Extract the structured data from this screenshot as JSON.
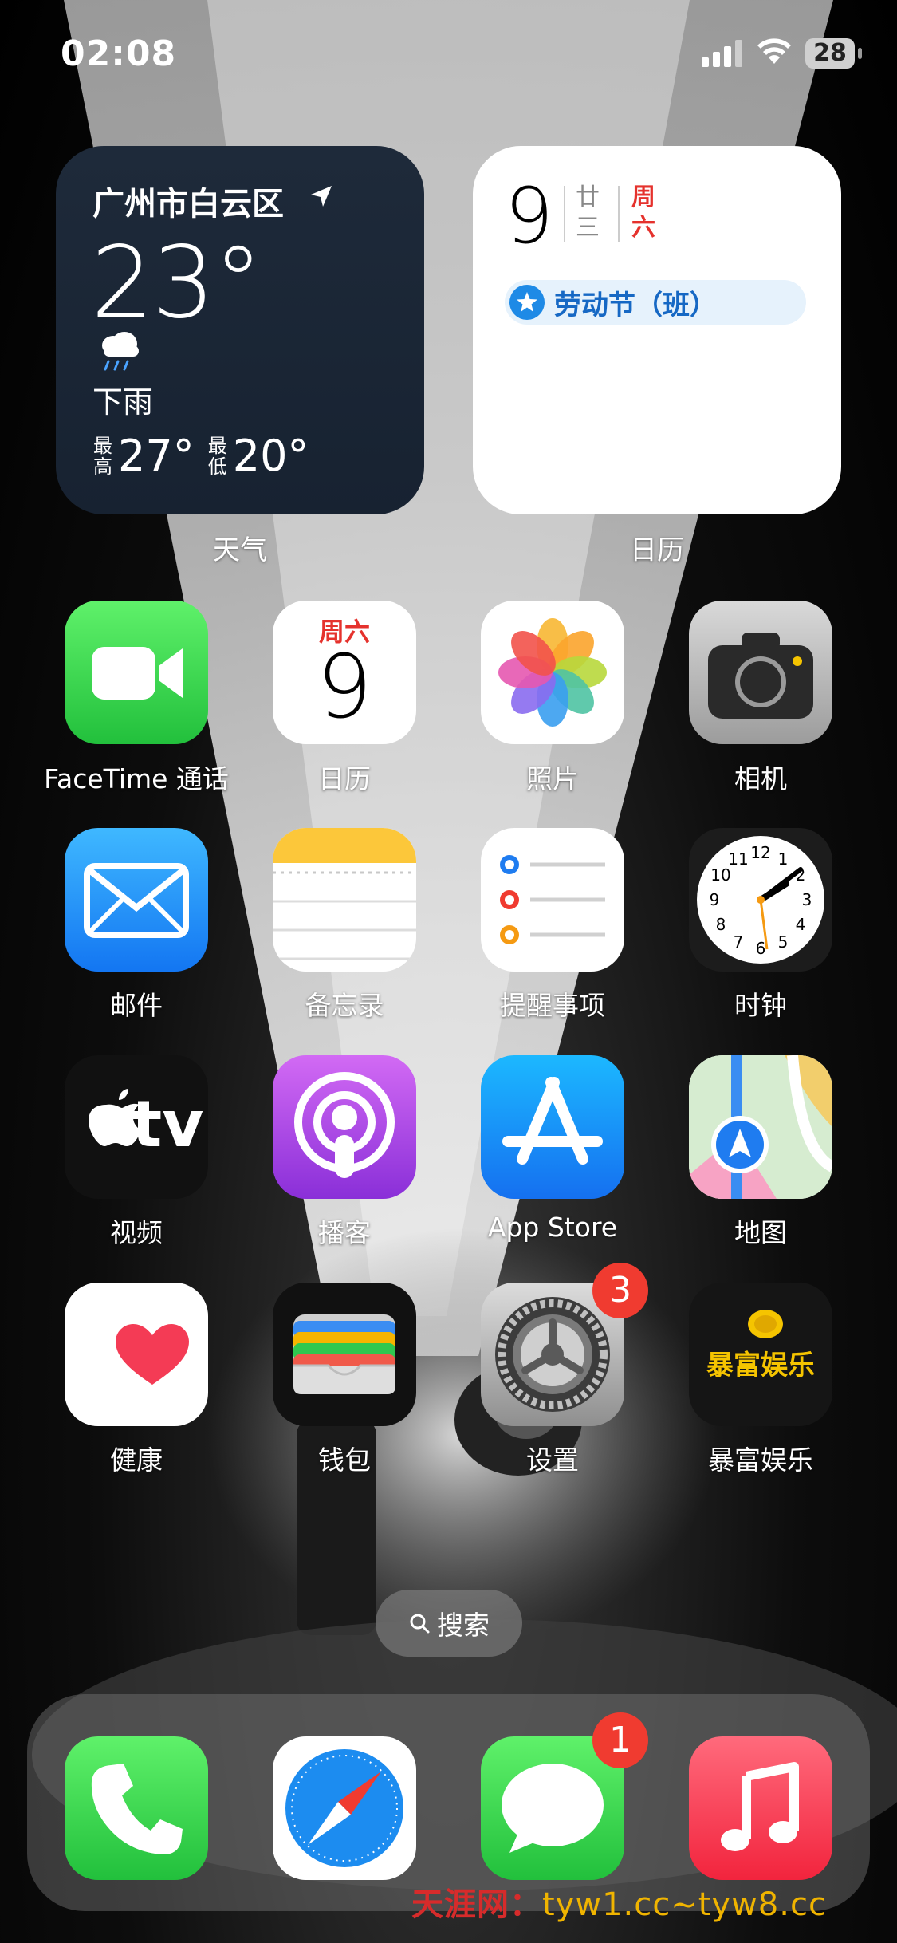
{
  "status_bar": {
    "time": "02:08",
    "battery_level": "28"
  },
  "widgets": {
    "weather": {
      "city": "广州市白云区",
      "temperature": "23°",
      "condition": "下雨",
      "high_label": "最高",
      "high": "27°",
      "low_label": "最低",
      "low": "20°",
      "label": "天气"
    },
    "calendar": {
      "day": "9",
      "lunar_1": "廿",
      "lunar_2": "三",
      "weekday_1": "周",
      "weekday_2": "六",
      "event": "劳动节（班）",
      "label": "日历"
    }
  },
  "apps": {
    "facetime": "FaceTime 通话",
    "calendar": "日历",
    "calendar_weekday": "周六",
    "calendar_day": "9",
    "photos": "照片",
    "camera": "相机",
    "mail": "邮件",
    "notes": "备忘录",
    "reminders": "提醒事项",
    "clock": "时钟",
    "tv": "视频",
    "tv_icon_text": "tv",
    "podcasts": "播客",
    "appstore": "App Store",
    "maps": "地图",
    "health": "健康",
    "wallet": "钱包",
    "settings": "设置",
    "settings_badge": "3",
    "baofu": "暴富娱乐",
    "baofu_icon_text": "暴富娱乐"
  },
  "search": {
    "label": "搜索"
  },
  "dock": {
    "messages_badge": "1"
  },
  "watermark": {
    "site": "天涯网：",
    "urls": "tyw1.cc~tyw8.cc"
  },
  "colors": {
    "badge_red": "#f03b30",
    "green": "#2fc84f",
    "blue": "#1e8ae6",
    "weather_bg": "#1e2a3a"
  }
}
